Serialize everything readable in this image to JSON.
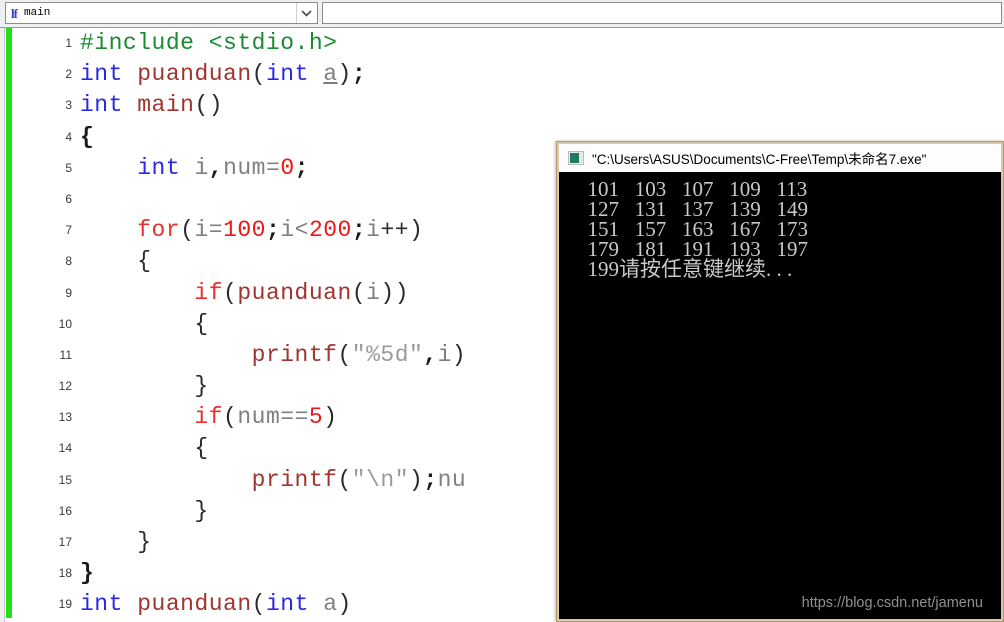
{
  "toolbar": {
    "scope_combo": {
      "icon": "function-symbol-icon",
      "icon_glyph": "lf",
      "value": "main",
      "arrow": "chevron-down-icon"
    },
    "second_combo": {
      "value": ""
    }
  },
  "editor": {
    "change_bar_color": "#22e019",
    "lines": [
      {
        "number": "1",
        "tokens": [
          {
            "t": "#include <stdio.h>",
            "c": "tok-pre"
          }
        ]
      },
      {
        "number": "2",
        "tokens": [
          {
            "t": "int",
            "c": "tok-kw"
          },
          {
            "t": " ",
            "c": "tok-plain"
          },
          {
            "t": "puanduan",
            "c": "tok-fn"
          },
          {
            "t": "(",
            "c": "tok-plain"
          },
          {
            "t": "int",
            "c": "tok-kw"
          },
          {
            "t": " ",
            "c": "tok-plain"
          },
          {
            "t": "a",
            "c": "tok-under"
          },
          {
            "t": ")",
            "c": "tok-plain"
          },
          {
            "t": ";",
            "c": "tok-punct"
          }
        ]
      },
      {
        "number": "3",
        "tokens": [
          {
            "t": "int",
            "c": "tok-kw"
          },
          {
            "t": " ",
            "c": "tok-plain"
          },
          {
            "t": "main",
            "c": "tok-fn"
          },
          {
            "t": "()",
            "c": "tok-plain"
          }
        ]
      },
      {
        "number": "4",
        "tokens": [
          {
            "t": "{",
            "c": "tok-brace"
          }
        ]
      },
      {
        "number": "5",
        "tokens": [
          {
            "t": "    ",
            "c": "tok-plain"
          },
          {
            "t": "int",
            "c": "tok-kw"
          },
          {
            "t": " ",
            "c": "tok-plain"
          },
          {
            "t": "i",
            "c": "tok-id"
          },
          {
            "t": ",",
            "c": "tok-punct"
          },
          {
            "t": "num",
            "c": "tok-id"
          },
          {
            "t": "=",
            "c": "tok-id"
          },
          {
            "t": "0",
            "c": "tok-num"
          },
          {
            "t": ";",
            "c": "tok-punct"
          }
        ]
      },
      {
        "number": "6",
        "tokens": []
      },
      {
        "number": "7",
        "tokens": [
          {
            "t": "    ",
            "c": "tok-plain"
          },
          {
            "t": "for",
            "c": "tok-ctl"
          },
          {
            "t": "(",
            "c": "tok-plain"
          },
          {
            "t": "i",
            "c": "tok-id"
          },
          {
            "t": "=",
            "c": "tok-id"
          },
          {
            "t": "100",
            "c": "tok-num"
          },
          {
            "t": ";",
            "c": "tok-punct"
          },
          {
            "t": "i",
            "c": "tok-id"
          },
          {
            "t": "<",
            "c": "tok-id"
          },
          {
            "t": "200",
            "c": "tok-num"
          },
          {
            "t": ";",
            "c": "tok-punct"
          },
          {
            "t": "i",
            "c": "tok-id"
          },
          {
            "t": "++)",
            "c": "tok-plain"
          }
        ]
      },
      {
        "number": "8",
        "tokens": [
          {
            "t": "    ",
            "c": "tok-plain"
          },
          {
            "t": "{",
            "c": "tok-plain"
          }
        ]
      },
      {
        "number": "9",
        "tokens": [
          {
            "t": "        ",
            "c": "tok-plain"
          },
          {
            "t": "if",
            "c": "tok-ctl"
          },
          {
            "t": "(",
            "c": "tok-plain"
          },
          {
            "t": "puanduan",
            "c": "tok-fn"
          },
          {
            "t": "(",
            "c": "tok-plain"
          },
          {
            "t": "i",
            "c": "tok-id"
          },
          {
            "t": "))",
            "c": "tok-plain"
          }
        ]
      },
      {
        "number": "10",
        "tokens": [
          {
            "t": "        ",
            "c": "tok-plain"
          },
          {
            "t": "{",
            "c": "tok-plain"
          }
        ]
      },
      {
        "number": "11",
        "tokens": [
          {
            "t": "            ",
            "c": "tok-plain"
          },
          {
            "t": "printf",
            "c": "tok-fn"
          },
          {
            "t": "(",
            "c": "tok-plain"
          },
          {
            "t": "\"%5d\"",
            "c": "tok-str"
          },
          {
            "t": ",",
            "c": "tok-punct"
          },
          {
            "t": "i",
            "c": "tok-id"
          },
          {
            "t": ")",
            "c": "tok-plain"
          }
        ]
      },
      {
        "number": "12",
        "tokens": [
          {
            "t": "        ",
            "c": "tok-plain"
          },
          {
            "t": "}",
            "c": "tok-plain"
          }
        ]
      },
      {
        "number": "13",
        "tokens": [
          {
            "t": "        ",
            "c": "tok-plain"
          },
          {
            "t": "if",
            "c": "tok-ctl"
          },
          {
            "t": "(",
            "c": "tok-plain"
          },
          {
            "t": "num",
            "c": "tok-id"
          },
          {
            "t": "==",
            "c": "tok-id"
          },
          {
            "t": "5",
            "c": "tok-num"
          },
          {
            "t": ")",
            "c": "tok-plain"
          }
        ]
      },
      {
        "number": "14",
        "tokens": [
          {
            "t": "        ",
            "c": "tok-plain"
          },
          {
            "t": "{",
            "c": "tok-plain"
          }
        ]
      },
      {
        "number": "15",
        "tokens": [
          {
            "t": "            ",
            "c": "tok-plain"
          },
          {
            "t": "printf",
            "c": "tok-fn"
          },
          {
            "t": "(",
            "c": "tok-plain"
          },
          {
            "t": "\"\\n\"",
            "c": "tok-str"
          },
          {
            "t": ")",
            "c": "tok-plain"
          },
          {
            "t": ";",
            "c": "tok-punct"
          },
          {
            "t": "nu",
            "c": "tok-id"
          }
        ]
      },
      {
        "number": "16",
        "tokens": [
          {
            "t": "        ",
            "c": "tok-plain"
          },
          {
            "t": "}",
            "c": "tok-plain"
          }
        ]
      },
      {
        "number": "17",
        "tokens": [
          {
            "t": "    ",
            "c": "tok-plain"
          },
          {
            "t": "}",
            "c": "tok-plain"
          }
        ]
      },
      {
        "number": "18",
        "tokens": [
          {
            "t": "}",
            "c": "tok-brace"
          }
        ]
      },
      {
        "number": "19",
        "tokens": [
          {
            "t": "int",
            "c": "tok-kw"
          },
          {
            "t": " ",
            "c": "tok-plain"
          },
          {
            "t": "puanduan",
            "c": "tok-fn"
          },
          {
            "t": "(",
            "c": "tok-plain"
          },
          {
            "t": "int",
            "c": "tok-kw"
          },
          {
            "t": " ",
            "c": "tok-plain"
          },
          {
            "t": "a",
            "c": "tok-id"
          },
          {
            "t": ")",
            "c": "tok-plain"
          }
        ]
      }
    ]
  },
  "console": {
    "icon": "console-app-icon",
    "title": "\"C:\\Users\\ASUS\\Documents\\C-Free\\Temp\\未命名7.exe\"",
    "output_lines": [
      "  101   103   107   109   113",
      "  127   131   137   139   149",
      "  151   157   163   167   173",
      "  179   181   191   193   197",
      "  199请按任意键继续. . ."
    ],
    "background": "#000000",
    "text_color": "#c9c9c9"
  },
  "watermark": {
    "text": "https://blog.csdn.net/jamenu"
  }
}
